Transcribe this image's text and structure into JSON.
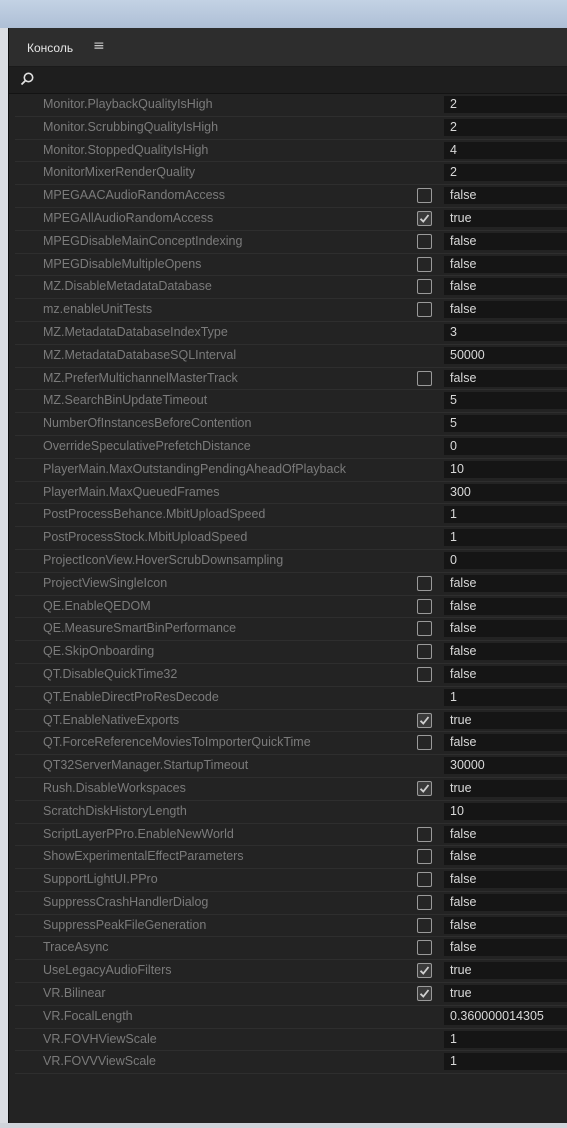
{
  "panel": {
    "title": "Консоль",
    "menu_icon": "hamburger-menu-icon"
  },
  "search": {
    "icon": "search-icon",
    "value": "",
    "placeholder": ""
  },
  "rows": [
    {
      "name": "Monitor.PlaybackQualityIsHigh",
      "value": "2",
      "checkbox": null
    },
    {
      "name": "Monitor.ScrubbingQualityIsHigh",
      "value": "2",
      "checkbox": null
    },
    {
      "name": "Monitor.StoppedQualityIsHigh",
      "value": "4",
      "checkbox": null
    },
    {
      "name": "MonitorMixerRenderQuality",
      "value": "2",
      "checkbox": null
    },
    {
      "name": "MPEGAACAudioRandomAccess",
      "value": "false",
      "checkbox": false
    },
    {
      "name": "MPEGAllAudioRandomAccess",
      "value": "true",
      "checkbox": true
    },
    {
      "name": "MPEGDisableMainConceptIndexing",
      "value": "false",
      "checkbox": false
    },
    {
      "name": "MPEGDisableMultipleOpens",
      "value": "false",
      "checkbox": false
    },
    {
      "name": "MZ.DisableMetadataDatabase",
      "value": "false",
      "checkbox": false
    },
    {
      "name": "mz.enableUnitTests",
      "value": "false",
      "checkbox": false
    },
    {
      "name": "MZ.MetadataDatabaseIndexType",
      "value": "3",
      "checkbox": null
    },
    {
      "name": "MZ.MetadataDatabaseSQLInterval",
      "value": "50000",
      "checkbox": null
    },
    {
      "name": "MZ.PreferMultichannelMasterTrack",
      "value": "false",
      "checkbox": false
    },
    {
      "name": "MZ.SearchBinUpdateTimeout",
      "value": "5",
      "checkbox": null
    },
    {
      "name": "NumberOfInstancesBeforeContention",
      "value": "5",
      "checkbox": null
    },
    {
      "name": "OverrideSpeculativePrefetchDistance",
      "value": "0",
      "checkbox": null
    },
    {
      "name": "PlayerMain.MaxOutstandingPendingAheadOfPlayback",
      "value": "10",
      "checkbox": null
    },
    {
      "name": "PlayerMain.MaxQueuedFrames",
      "value": "300",
      "checkbox": null
    },
    {
      "name": "PostProcessBehance.MbitUploadSpeed",
      "value": "1",
      "checkbox": null
    },
    {
      "name": "PostProcessStock.MbitUploadSpeed",
      "value": "1",
      "checkbox": null
    },
    {
      "name": "ProjectIconView.HoverScrubDownsampling",
      "value": "0",
      "checkbox": null
    },
    {
      "name": "ProjectViewSingleIcon",
      "value": "false",
      "checkbox": false
    },
    {
      "name": "QE.EnableQEDOM",
      "value": "false",
      "checkbox": false
    },
    {
      "name": "QE.MeasureSmartBinPerformance",
      "value": "false",
      "checkbox": false
    },
    {
      "name": "QE.SkipOnboarding",
      "value": "false",
      "checkbox": false
    },
    {
      "name": "QT.DisableQuickTime32",
      "value": "false",
      "checkbox": false
    },
    {
      "name": "QT.EnableDirectProResDecode",
      "value": "1",
      "checkbox": null
    },
    {
      "name": "QT.EnableNativeExports",
      "value": "true",
      "checkbox": true
    },
    {
      "name": "QT.ForceReferenceMoviesToImporterQuickTime",
      "value": "false",
      "checkbox": false
    },
    {
      "name": "QT32ServerManager.StartupTimeout",
      "value": "30000",
      "checkbox": null
    },
    {
      "name": "Rush.DisableWorkspaces",
      "value": "true",
      "checkbox": true
    },
    {
      "name": "ScratchDiskHistoryLength",
      "value": "10",
      "checkbox": null
    },
    {
      "name": "ScriptLayerPPro.EnableNewWorld",
      "value": "false",
      "checkbox": false
    },
    {
      "name": "ShowExperimentalEffectParameters",
      "value": "false",
      "checkbox": false
    },
    {
      "name": "SupportLightUI.PPro",
      "value": "false",
      "checkbox": false
    },
    {
      "name": "SuppressCrashHandlerDialog",
      "value": "false",
      "checkbox": false
    },
    {
      "name": "SuppressPeakFileGeneration",
      "value": "false",
      "checkbox": false
    },
    {
      "name": "TraceAsync",
      "value": "false",
      "checkbox": false
    },
    {
      "name": "UseLegacyAudioFilters",
      "value": "true",
      "checkbox": true
    },
    {
      "name": "VR.Bilinear",
      "value": "true",
      "checkbox": true
    },
    {
      "name": "VR.FocalLength",
      "value": "0.360000014305",
      "checkbox": null
    },
    {
      "name": "VR.FOVHViewScale",
      "value": "1",
      "checkbox": null
    },
    {
      "name": "VR.FOVVViewScale",
      "value": "1",
      "checkbox": null
    }
  ]
}
